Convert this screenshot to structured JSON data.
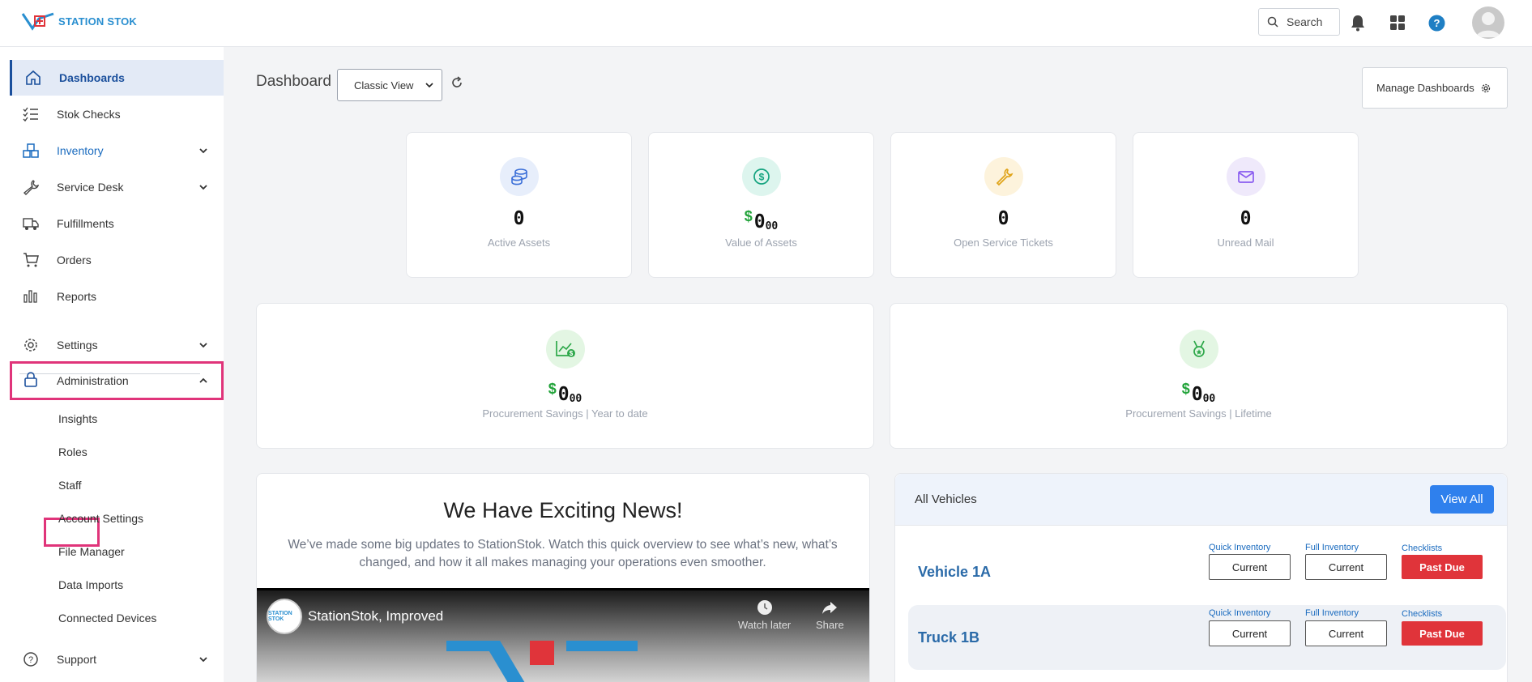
{
  "brand": {
    "name": "STATION STOK"
  },
  "header": {
    "search_label": "Search"
  },
  "sidebar": {
    "items": [
      {
        "label": "Dashboards"
      },
      {
        "label": "Stok Checks"
      },
      {
        "label": "Inventory"
      },
      {
        "label": "Service Desk"
      },
      {
        "label": "Fulfillments"
      },
      {
        "label": "Orders"
      },
      {
        "label": "Reports"
      },
      {
        "label": "Settings"
      },
      {
        "label": "Administration"
      },
      {
        "label": "Support"
      }
    ],
    "admin_sub": [
      {
        "label": "Insights"
      },
      {
        "label": "Roles"
      },
      {
        "label": "Staff"
      },
      {
        "label": "Account Settings"
      },
      {
        "label": "File Manager"
      },
      {
        "label": "Data Imports"
      },
      {
        "label": "Connected Devices"
      }
    ]
  },
  "main": {
    "title": "Dashboard",
    "view_select": "Classic View",
    "manage_label": "Manage Dashboards",
    "stats": [
      {
        "value": "0",
        "label": "Active Assets"
      },
      {
        "dollar": "$",
        "value": "0",
        "cents": "00",
        "label": "Value of Assets"
      },
      {
        "value": "0",
        "label": "Open Service Tickets"
      },
      {
        "value": "0",
        "label": "Unread Mail"
      }
    ],
    "savings": [
      {
        "dollar": "$",
        "value": "0",
        "cents": "00",
        "label": "Procurement Savings | Year to date"
      },
      {
        "dollar": "$",
        "value": "0",
        "cents": "00",
        "label": "Procurement Savings | Lifetime"
      }
    ],
    "news": {
      "title": "We Have Exciting News!",
      "body": "We’ve made some big updates to StationStok. Watch this quick overview to see what’s new, what’s changed, and how it all makes managing your operations even smoother.",
      "video_title": "StationStok, Improved",
      "watch_later": "Watch later",
      "share": "Share",
      "channel_badge": "STATION STOK"
    },
    "vehicles": {
      "title": "All Vehicles",
      "view_all": "View All",
      "col_quick": "Quick Inventory",
      "col_full": "Full Inventory",
      "col_checklists": "Checklists",
      "rows": [
        {
          "name": "Vehicle 1A",
          "quick": "Current",
          "full": "Current",
          "checklists": "Past Due"
        },
        {
          "name": "Truck 1B",
          "quick": "Current",
          "full": "Current",
          "checklists": "Past Due"
        }
      ]
    }
  },
  "colors": {
    "accent": "#1a4f9c",
    "highlight": "#e0347a",
    "danger": "#e0343a",
    "primary_button": "#2f80ed",
    "money": "#22a33a"
  }
}
